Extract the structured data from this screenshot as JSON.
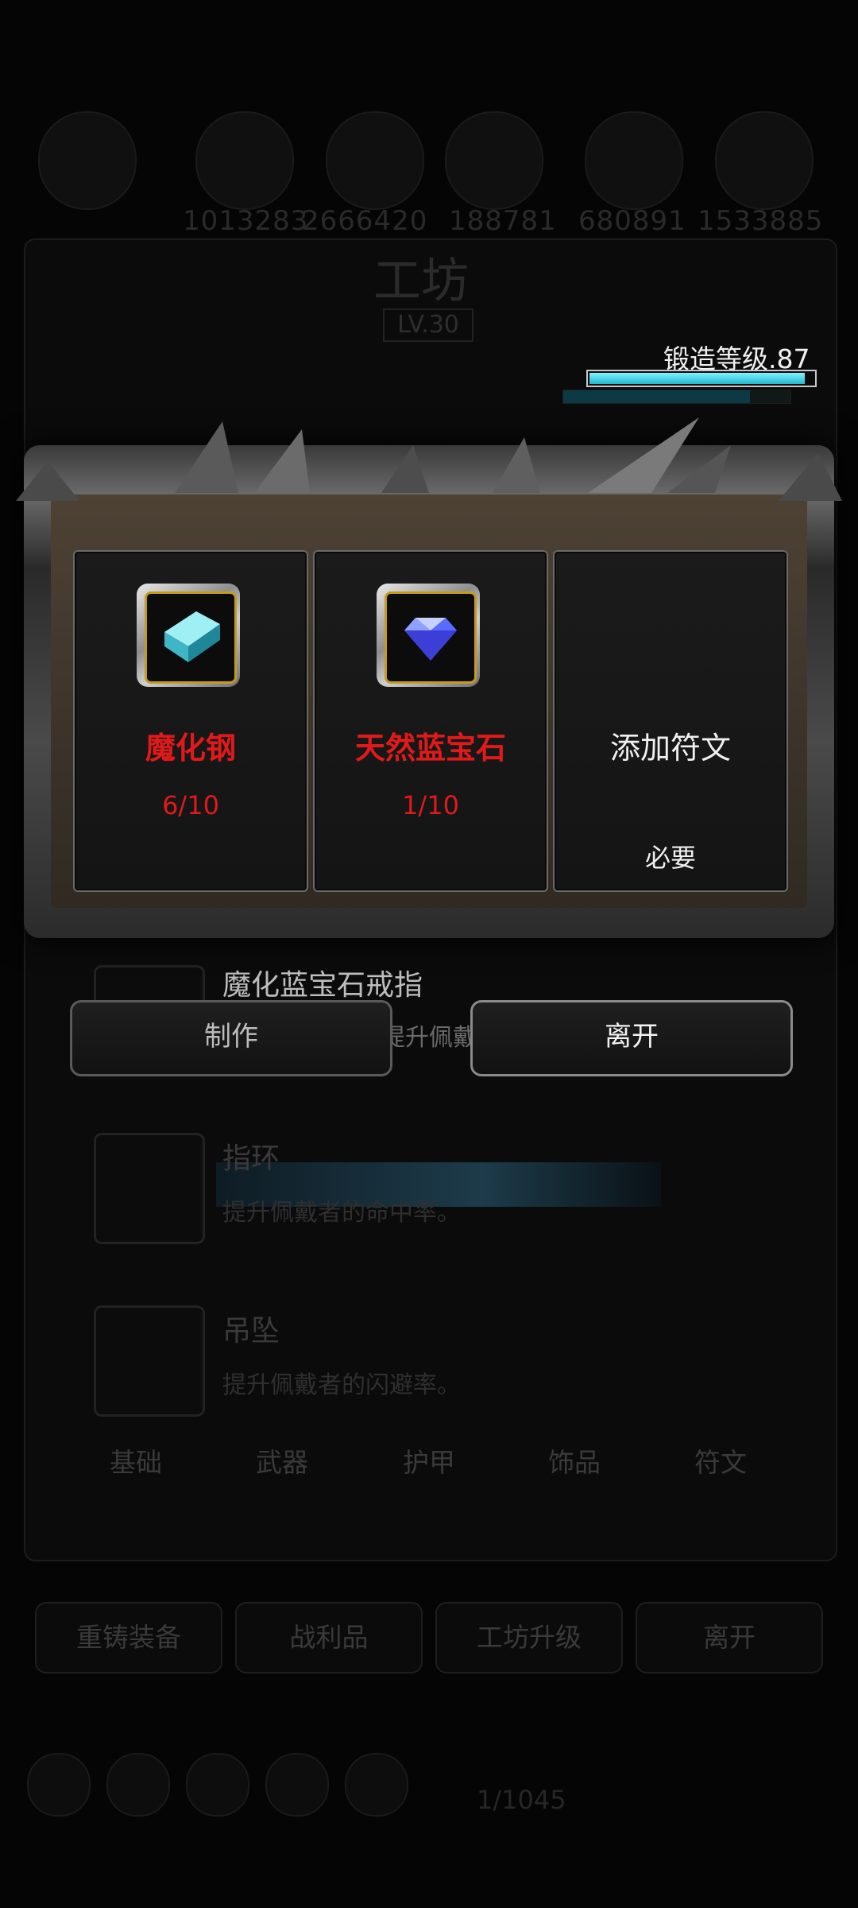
{
  "background": {
    "resource_numbers": [
      "1013283",
      "2666420",
      "188781",
      "680891",
      "1533885"
    ],
    "workshop_title": "工坊",
    "workshop_level": "LV.30",
    "forge_level_label": "锻造等级.87",
    "forge_progress": 0.96,
    "forge_secondary_progress": 0.82,
    "items": [
      {
        "name": "魔化蓝宝石戒指",
        "desc": "提升佩戴者的命中率和"
      },
      {
        "name": "指环",
        "desc": "提升佩戴者的命中率。"
      },
      {
        "name": "吊坠",
        "desc": "提升佩戴者的闪避率。"
      }
    ],
    "tabs": [
      "基础",
      "武器",
      "护甲",
      "饰品",
      "符文"
    ],
    "bottom_buttons": [
      "重铸装备",
      "战利品",
      "工坊升级",
      "离开"
    ],
    "inventory_count": "1/1045"
  },
  "dialog": {
    "slots": [
      {
        "name": "魔化钢",
        "count": "6/10",
        "icon": "steel-ingot-icon",
        "color": "#e01a1a"
      },
      {
        "name": "天然蓝宝石",
        "count": "1/10",
        "icon": "sapphire-gem-icon",
        "color": "#e01a1a"
      },
      {
        "name": "添加符文",
        "requirement": "必要",
        "color": "#f0f0f0"
      }
    ],
    "craft_button": "制作",
    "leave_button": "离开"
  },
  "colors": {
    "missing_red": "#e01a1a",
    "forge_bar": "#24b8d0",
    "gold_border": "#c69a1b"
  }
}
